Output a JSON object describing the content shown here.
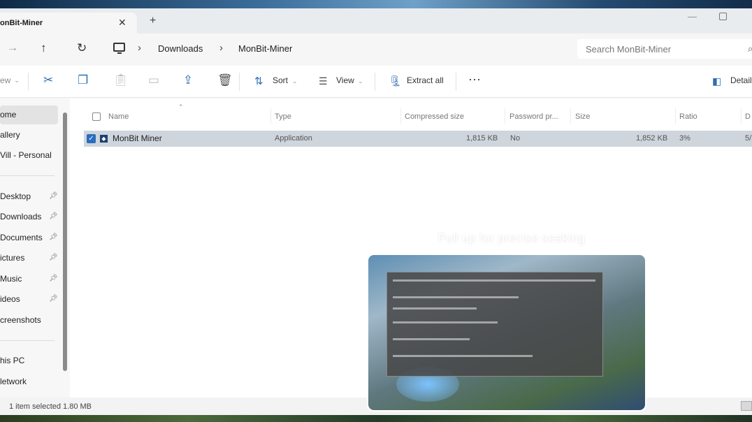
{
  "window": {
    "tab_title": "onBit-Miner",
    "tab_close": "✕",
    "new_tab": "+",
    "minimize": "—"
  },
  "address": {
    "forward": "→",
    "up": "↑",
    "refresh": "↻",
    "separator": "›",
    "crumbs": [
      "Downloads",
      "MonBit-Miner"
    ],
    "search_placeholder": "Search MonBit-Miner"
  },
  "toolbar": {
    "new_label": "ew",
    "sort_label": "Sort",
    "view_label": "View",
    "extract_label": "Extract all",
    "more_label": "···",
    "details_label": "Detail"
  },
  "nav": {
    "items": [
      {
        "label": "ome"
      },
      {
        "label": "allery"
      },
      {
        "label": "Vill - Personal"
      },
      {
        "label": "Desktop"
      },
      {
        "label": "Downloads"
      },
      {
        "label": "Documents"
      },
      {
        "label": "ictures"
      },
      {
        "label": "Music"
      },
      {
        "label": "ideos"
      },
      {
        "label": "creenshots"
      },
      {
        "label": "his PC"
      },
      {
        "label": "letwork"
      }
    ]
  },
  "filelist": {
    "columns": [
      "Name",
      "Type",
      "Compressed size",
      "Password pr...",
      "Size",
      "Ratio",
      "D"
    ],
    "rows": [
      {
        "name": "MonBit Miner",
        "type": "Application",
        "compressed_size": "1,815 KB",
        "password_protected": "No",
        "size": "1,852 KB",
        "ratio": "3%",
        "date": "5/"
      }
    ]
  },
  "status": {
    "text": "1 item selected  1.80 MB"
  },
  "video_overlay": {
    "hint": "Pull up for precise seeking"
  },
  "colors": {
    "accent": "#2a6ebd",
    "selected_row": "#cfd5dc",
    "window_bg": "#f6f6f6"
  }
}
